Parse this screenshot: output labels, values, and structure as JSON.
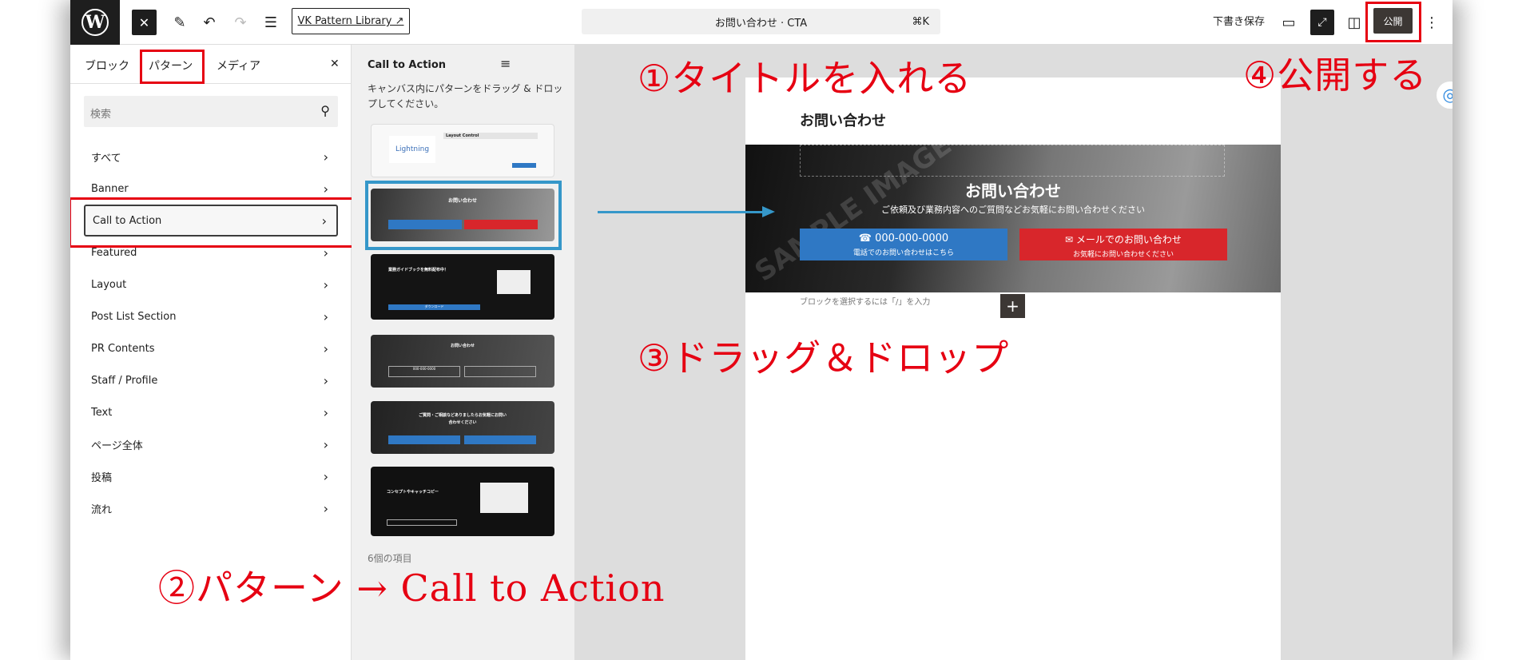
{
  "topbar": {
    "logo": "W",
    "close": "✕",
    "site_link": "VK Pattern Library ↗",
    "command": "お問い合わせ · CTA",
    "shortcut": "⌘K",
    "draft": "下書き保存",
    "publish": "公開"
  },
  "inserter": {
    "tabs": [
      "ブロック",
      "パターン",
      "メディア"
    ],
    "close": "✕",
    "search_placeholder": "検索",
    "categories": [
      "すべて",
      "Banner",
      "Call to Action",
      "Featured",
      "Layout",
      "Post List Section",
      "PR Contents",
      "Staff / Profile",
      "Text",
      "ページ全体",
      "投稿",
      "流れ"
    ],
    "selected": "Call to Action"
  },
  "patterns": {
    "title": "Call to Action",
    "hint": "キャンバス内にパターンをドラッグ & ドロップしてください。",
    "count": "6個の項目",
    "thumbs": [
      {
        "title": "Layout Control",
        "logo": "Lightning"
      },
      {
        "title": "お問い合わせ"
      },
      {
        "title": "業務ガイドブックを無料配布中！",
        "button": "ダウンロード"
      },
      {
        "title": "お問い合わせ",
        "tel": "000-000-0000"
      },
      {
        "title": "ご質問・ご相談などありましたらお気軽にお問い合わせください"
      },
      {
        "title": "コンセプトやキャッチコピー"
      }
    ]
  },
  "canvas": {
    "page_title": "お問い合わせ",
    "cta_heading": "お問い合わせ",
    "cta_sub": "ご依頼及び業務内容へのご質問などお気軽にお問い合わせください",
    "tel_button": {
      "label": "000-000-0000",
      "sub": "電話でのお問い合わせはこちら",
      "color": "#2f78c4"
    },
    "mail_button": {
      "label": "メールでのお問い合わせ",
      "sub": "お気軽にお問い合わせください",
      "color": "#d8262b"
    },
    "watermark": "SAMPLE IMAGE",
    "placeholder": "ブロックを選択するには「/」を入力",
    "add": "+"
  },
  "annotations": {
    "step1": "①タイトルを入れる",
    "step2": "②パターン → Call to Action",
    "step3": "③ドラッグ＆ドロップ",
    "step4": "④公開する",
    "color": "#e60012"
  }
}
